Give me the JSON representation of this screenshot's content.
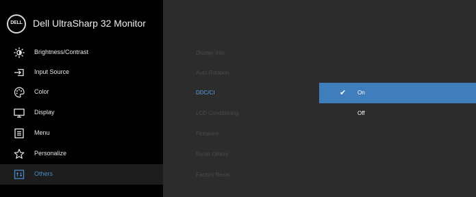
{
  "header": {
    "brand_logo": "DELL",
    "title": "Dell UltraSharp 32 Monitor"
  },
  "menu": [
    {
      "label": "Brightness/Contrast",
      "icon": "brightness-icon"
    },
    {
      "label": "Input Source",
      "icon": "input-source-icon"
    },
    {
      "label": "Color",
      "icon": "color-palette-icon"
    },
    {
      "label": "Display",
      "icon": "display-icon"
    },
    {
      "label": "Menu",
      "icon": "menu-icon"
    },
    {
      "label": "Personalize",
      "icon": "star-icon"
    },
    {
      "label": "Others",
      "icon": "others-icon",
      "active": true
    }
  ],
  "submenu": [
    {
      "label": "Display Info"
    },
    {
      "label": "Auto Rotation"
    },
    {
      "label": "DDC/CI",
      "active": true
    },
    {
      "label": "LCD Conditioning"
    },
    {
      "label": "Firmware"
    },
    {
      "label": "Reset Others"
    },
    {
      "label": "Factory Reset"
    }
  ],
  "options": [
    {
      "label": "On",
      "selected": true,
      "check": "✔"
    },
    {
      "label": "Off",
      "selected": false
    }
  ],
  "colors": {
    "accent": "#3f7dbd",
    "active_text": "#4a89c9",
    "sidebar_bg": "#000000",
    "panel_bg": "#2c2c2c"
  }
}
